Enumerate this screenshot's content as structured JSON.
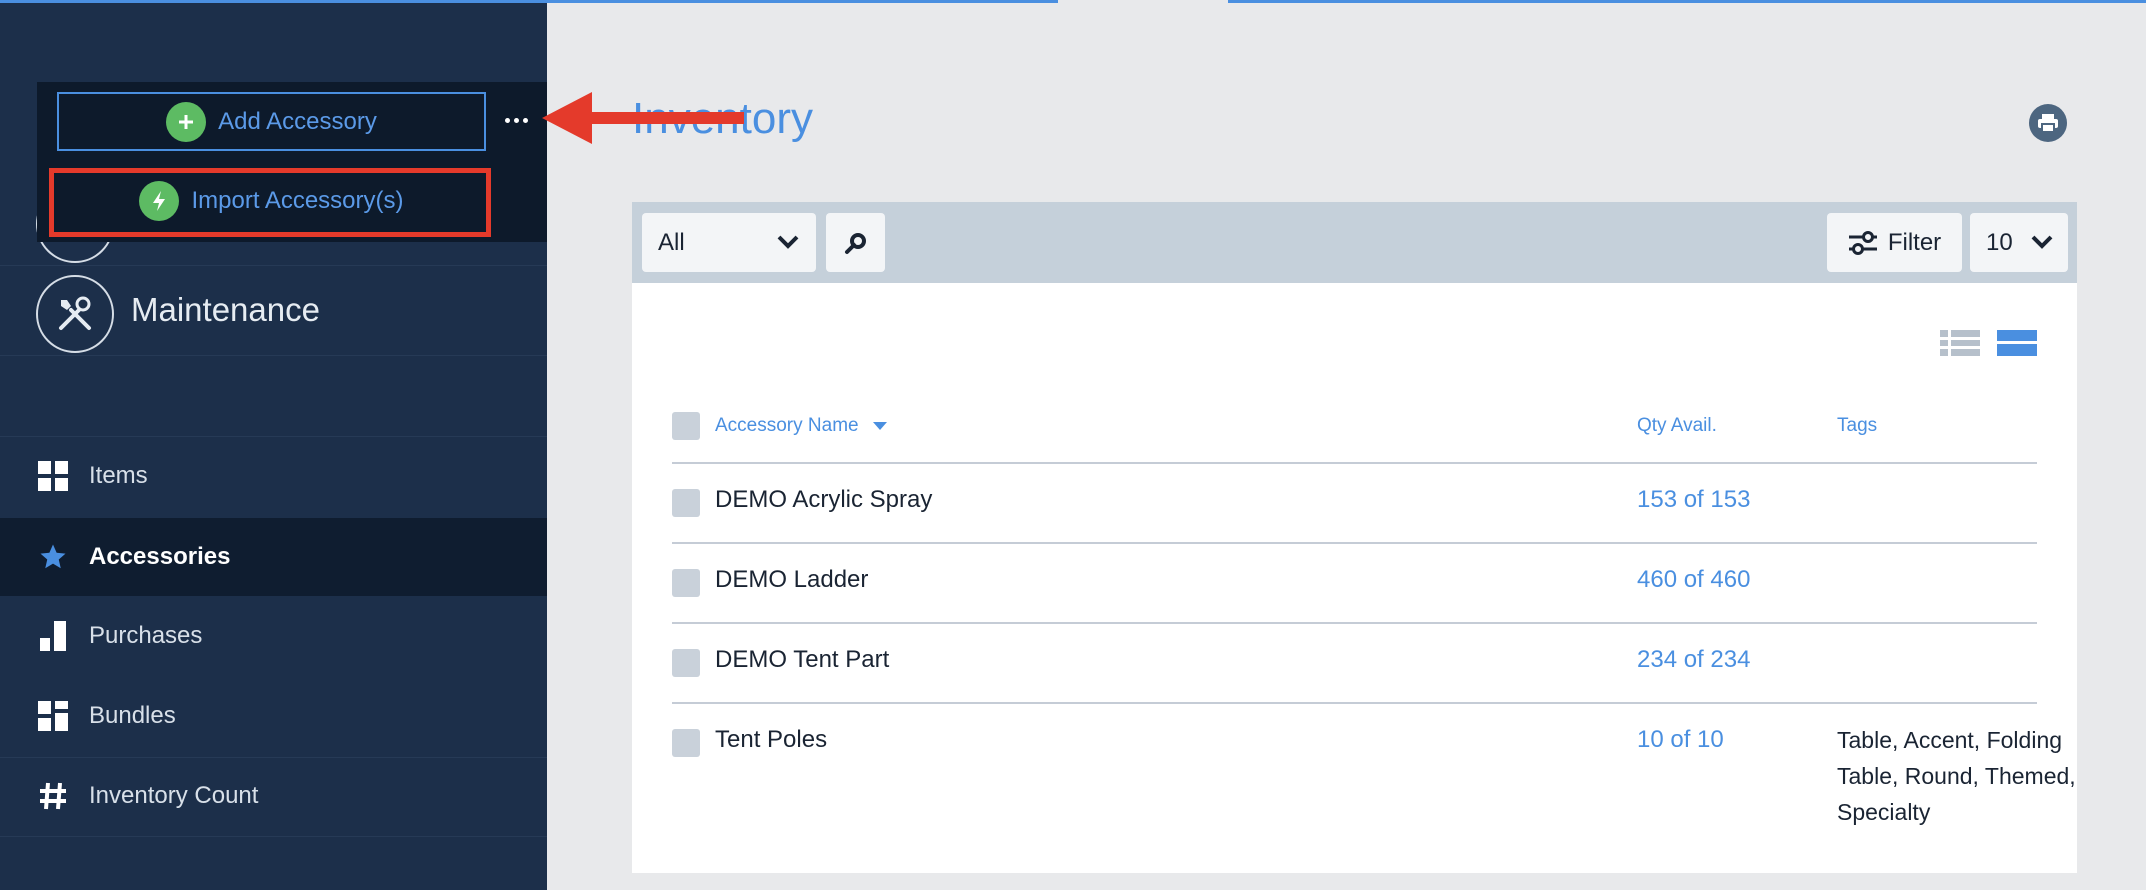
{
  "popup": {
    "add_label": "Add Accessory",
    "import_label": "Import Accessory(s)"
  },
  "sidebar": {
    "maintenance_label": "Maintenance",
    "items": [
      {
        "label": "Items",
        "icon": "grid-icon"
      },
      {
        "label": "Accessories",
        "icon": "star-icon",
        "active": true
      },
      {
        "label": "Purchases",
        "icon": "bar-chart-icon"
      },
      {
        "label": "Bundles",
        "icon": "bundles-icon"
      },
      {
        "label": "Inventory Count",
        "icon": "hash-icon"
      }
    ]
  },
  "main": {
    "title": "Inventory",
    "toolbar": {
      "select_value": "All",
      "filter_label": "Filter",
      "per_page": "10"
    },
    "table": {
      "headers": {
        "name": "Accessory Name",
        "qty": "Qty Avail.",
        "tags": "Tags"
      },
      "rows": [
        {
          "name": "DEMO Acrylic Spray",
          "qty": "153 of 153",
          "tags": ""
        },
        {
          "name": "DEMO Ladder",
          "qty": "460 of 460",
          "tags": ""
        },
        {
          "name": "DEMO Tent Part",
          "qty": "234 of 234",
          "tags": ""
        },
        {
          "name": "Tent Poles",
          "qty": "10 of 10",
          "tags": "Table, Accent, Folding Table, Round, Themed, Specialty"
        }
      ]
    }
  },
  "colors": {
    "accent": "#4a8fe0",
    "sidebar_bg": "#1c2f4a",
    "highlight": "#e43a2b",
    "success": "#5dbb63"
  }
}
